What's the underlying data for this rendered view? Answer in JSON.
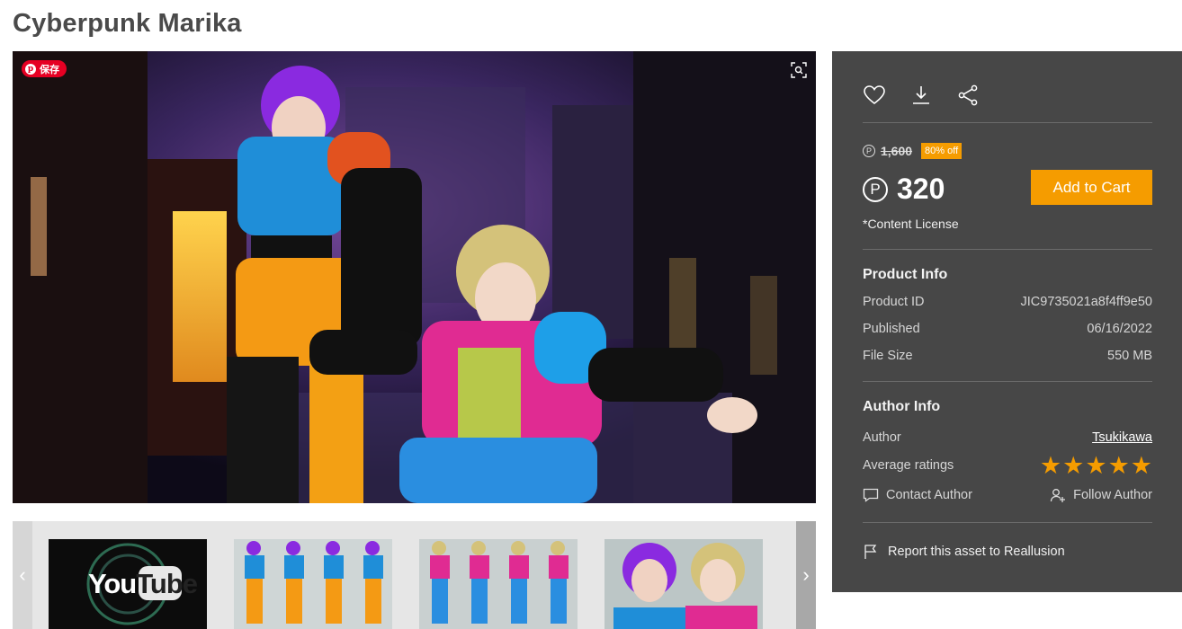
{
  "product": {
    "title": "Cyberpunk Marika"
  },
  "hero": {
    "pinterest_save_label": "保存"
  },
  "thumbnails": {
    "youtube_text_you": "You",
    "youtube_text_tube": "Tube"
  },
  "pricing": {
    "currency_symbol": "P",
    "original_price": "1,600",
    "discount_badge": "80% off",
    "current_price": "320",
    "add_to_cart_label": "Add to Cart",
    "license_link": "*Content License"
  },
  "product_info": {
    "heading": "Product Info",
    "rows": [
      {
        "label": "Product ID",
        "value": "JIC9735021a8f4ff9e50"
      },
      {
        "label": "Published",
        "value": "06/16/2022"
      },
      {
        "label": "File Size",
        "value": "550 MB"
      }
    ]
  },
  "author_info": {
    "heading": "Author Info",
    "author_label": "Author",
    "author_name": "Tsukikawa",
    "ratings_label": "Average ratings",
    "rating": 5,
    "rating_max": 5,
    "contact_label": "Contact Author",
    "follow_label": "Follow Author"
  },
  "report": {
    "label": "Report this asset to Reallusion"
  },
  "colors": {
    "accent": "#f59c00",
    "panel_bg": "#474747",
    "pinterest": "#e60023"
  },
  "icons": {
    "favorite": "heart-icon",
    "download": "download-icon",
    "share": "share-icon",
    "contact": "chat-bubble-icon",
    "follow": "user-plus-icon",
    "report": "flag-icon",
    "visual_search": "visual-search-icon"
  }
}
